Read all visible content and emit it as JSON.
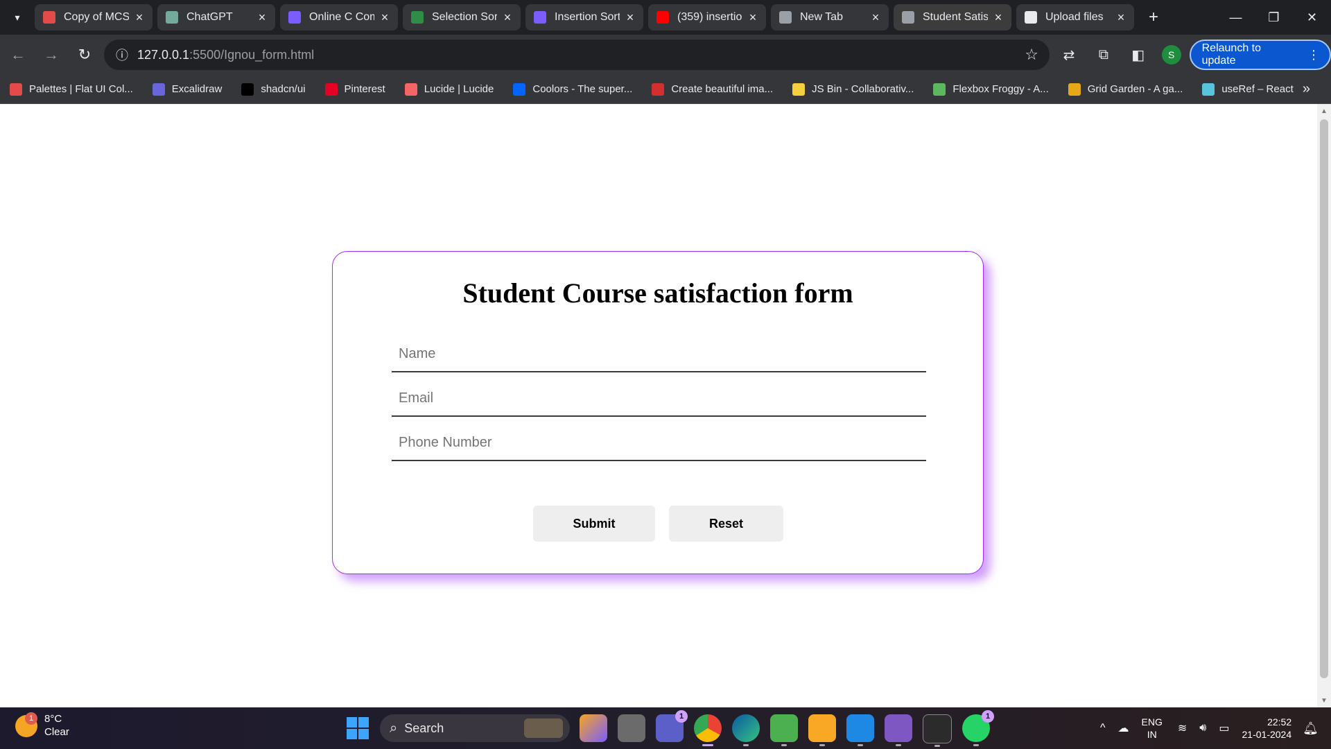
{
  "browser": {
    "tabs": [
      {
        "title": "Copy of MCS",
        "favicon_color": "#e34b4b",
        "active": false
      },
      {
        "title": "ChatGPT",
        "favicon_color": "#74aa9c",
        "active": false
      },
      {
        "title": "Online C Com",
        "favicon_color": "#7b5cff",
        "active": false
      },
      {
        "title": "Selection Sor",
        "favicon_color": "#2f8d46",
        "active": false
      },
      {
        "title": "Insertion Sort",
        "favicon_color": "#7b5cff",
        "active": false
      },
      {
        "title": "(359) insertio",
        "favicon_color": "#ff0000",
        "active": false
      },
      {
        "title": "New Tab",
        "favicon_color": "#9aa0a6",
        "active": false
      },
      {
        "title": "Student Satis",
        "favicon_color": "#9aa0a6",
        "active": true
      },
      {
        "title": "Upload files",
        "favicon_color": "#e8eaed",
        "active": false
      }
    ],
    "url_host": "127.0.0.1",
    "url_path": ":5500/Ignou_form.html",
    "avatar_letter": "S",
    "relaunch_label": "Relaunch to update",
    "bookmarks": [
      {
        "label": "Palettes | Flat UI Col...",
        "color": "#e34b4b"
      },
      {
        "label": "Excalidraw",
        "color": "#6965db"
      },
      {
        "label": "shadcn/ui",
        "color": "#000000"
      },
      {
        "label": "Pinterest",
        "color": "#e60023"
      },
      {
        "label": "Lucide | Lucide",
        "color": "#f56565"
      },
      {
        "label": "Coolors - The super...",
        "color": "#0066ff"
      },
      {
        "label": "Create beautiful ima...",
        "color": "#d32f2f"
      },
      {
        "label": "JS Bin - Collaborativ...",
        "color": "#f4d03f"
      },
      {
        "label": "Flexbox Froggy - A...",
        "color": "#5cb85c"
      },
      {
        "label": "Grid Garden - A ga...",
        "color": "#e6a817"
      },
      {
        "label": "useRef – React",
        "color": "#58c4dc"
      }
    ]
  },
  "page": {
    "title": "Student Course satisfaction form",
    "fields": {
      "name_placeholder": "Name",
      "email_placeholder": "Email",
      "phone_placeholder": "Phone Number"
    },
    "submit_label": "Submit",
    "reset_label": "Reset"
  },
  "taskbar": {
    "weather_badge": "1",
    "temperature": "8°C",
    "condition": "Clear",
    "search_label": "Search",
    "teams_badge": "1",
    "whatsapp_badge": "1",
    "lang_line1": "ENG",
    "lang_line2": "IN",
    "time": "22:52",
    "date": "21-01-2024"
  }
}
